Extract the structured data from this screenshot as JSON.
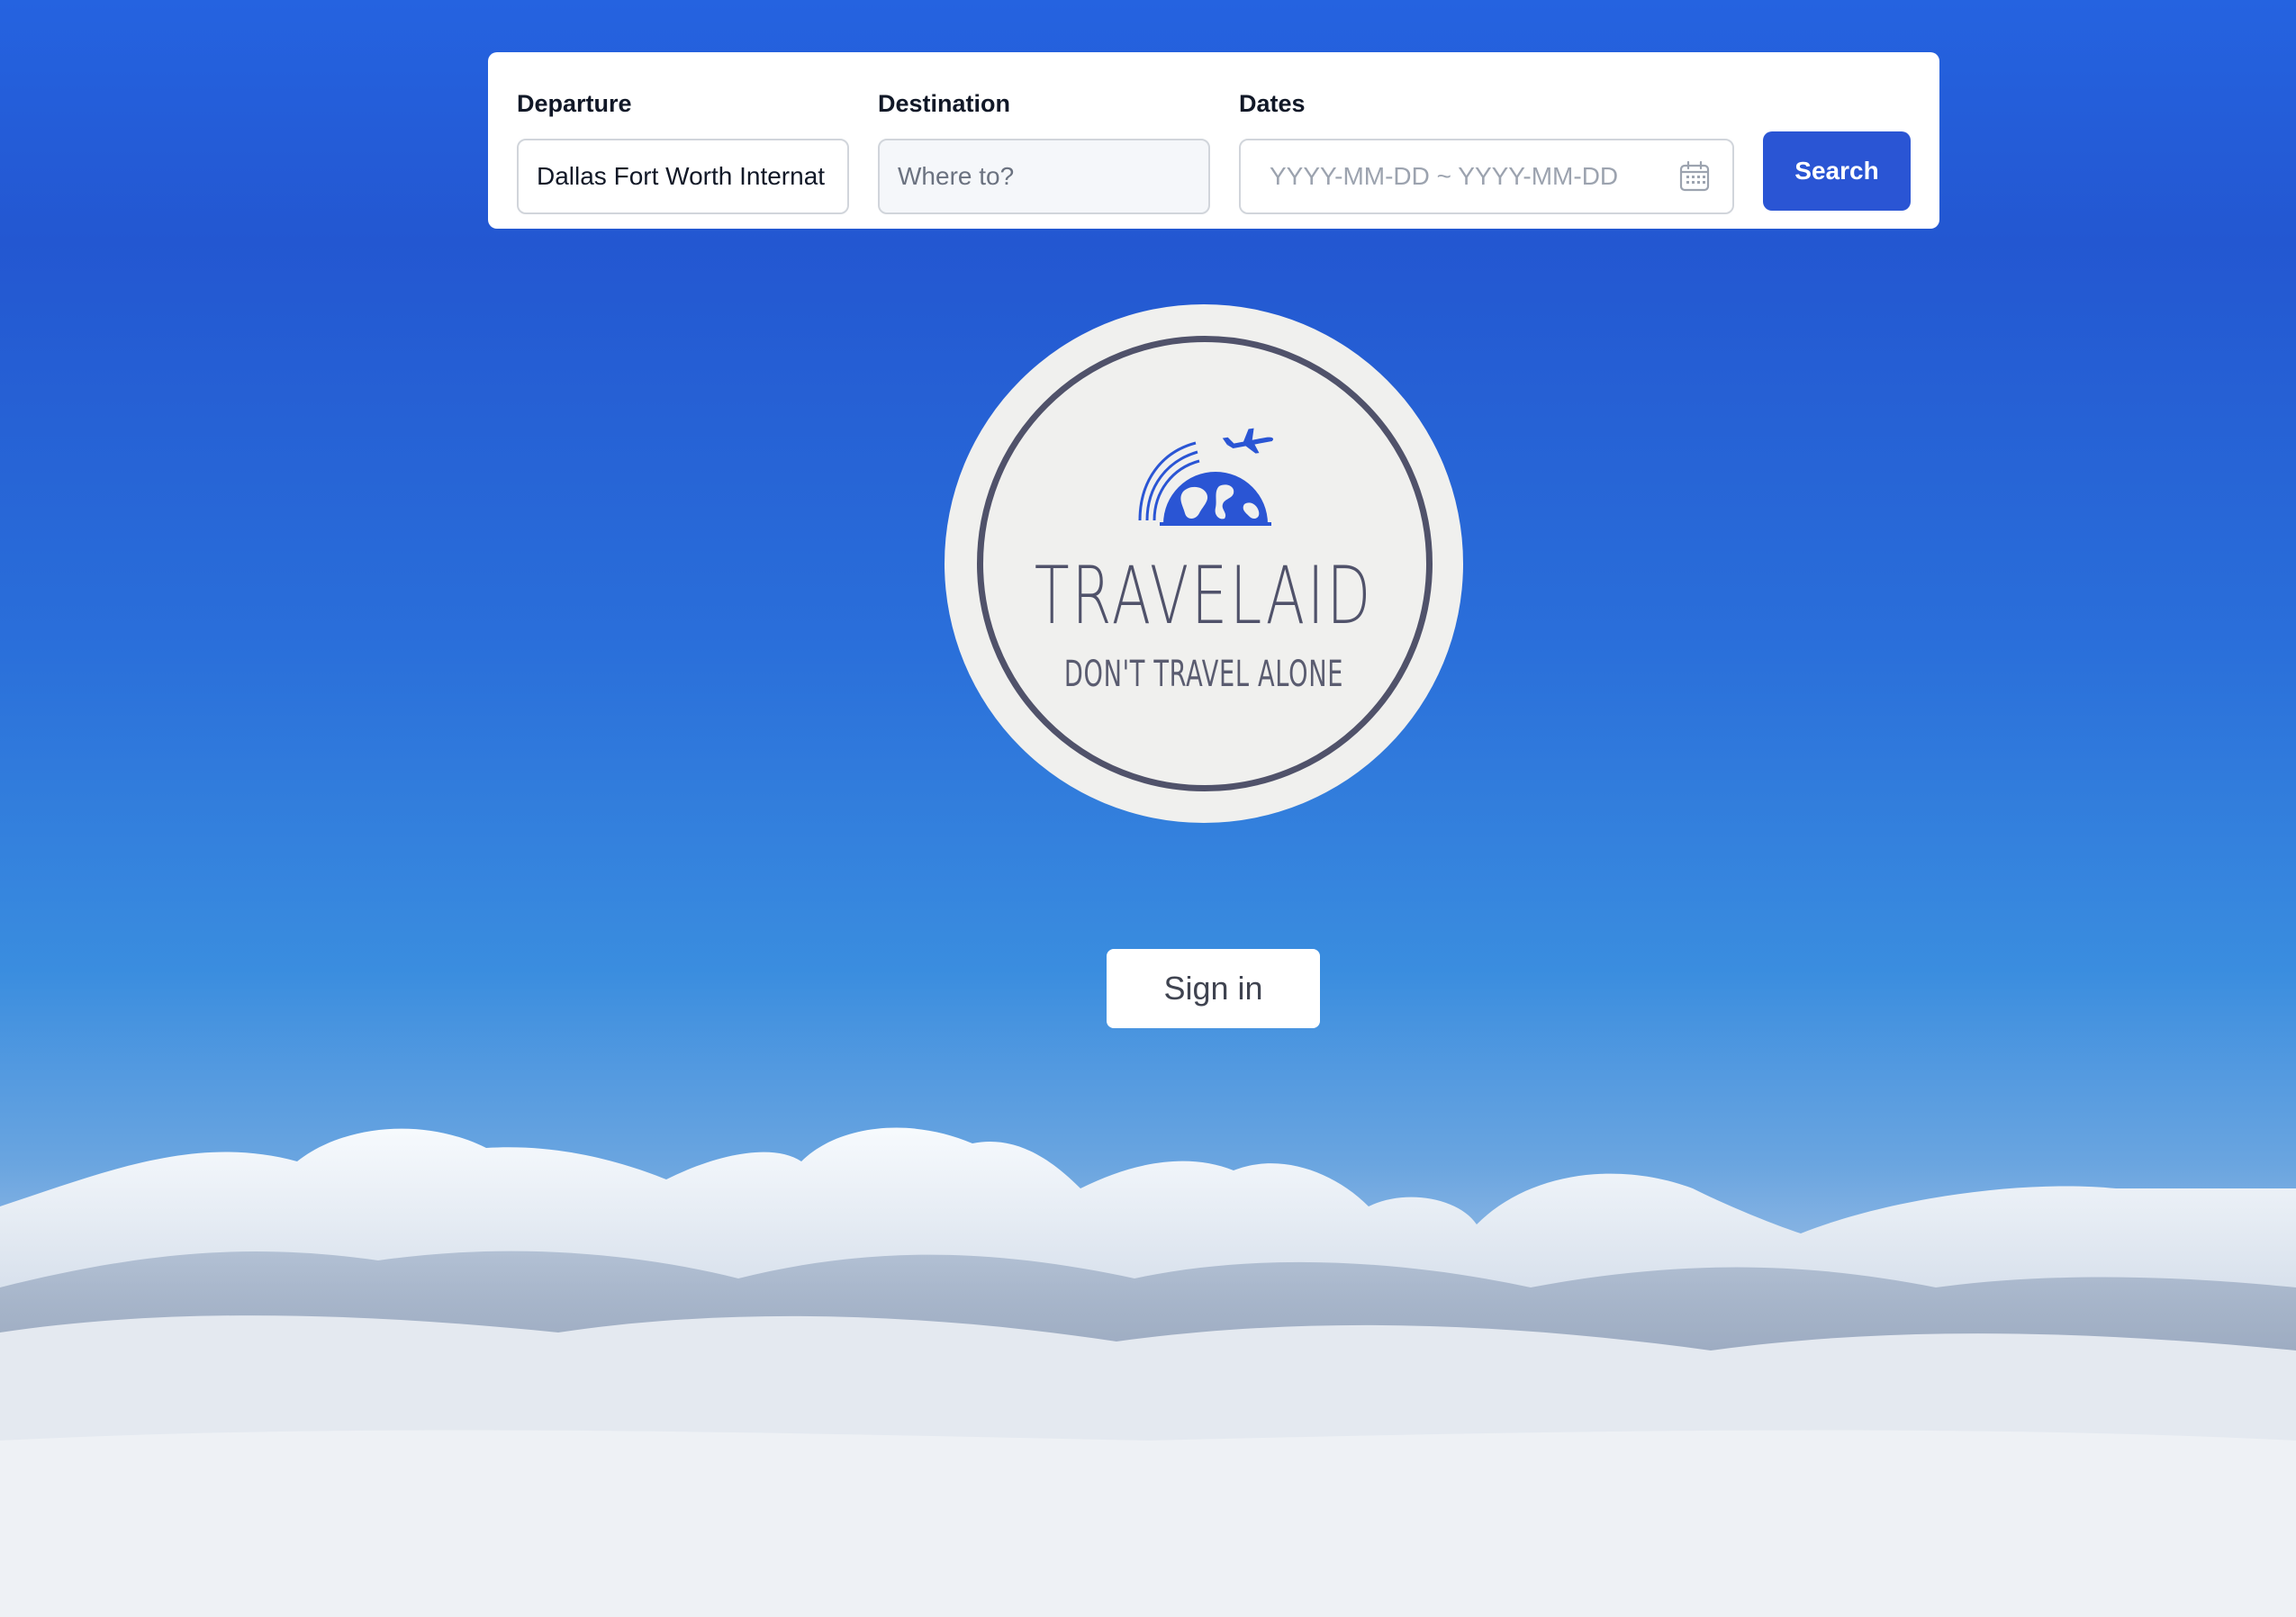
{
  "search": {
    "departure_label": "Departure",
    "departure_value": "Dallas Fort Worth Internat",
    "destination_label": "Destination",
    "destination_placeholder": "Where to?",
    "dates_label": "Dates",
    "dates_placeholder": "YYYY-MM-DD ~ YYYY-MM-DD",
    "search_label": "Search"
  },
  "logo": {
    "title": "TRAVELAID",
    "tagline": "DON'T TRAVEL ALONE"
  },
  "auth": {
    "signin_label": "Sign in"
  },
  "colors": {
    "accent": "#2a55d4",
    "logo_text": "#50526a",
    "sky": "#2563e0"
  },
  "icons": {
    "calendar": "calendar-icon",
    "globe": "globe-plane-icon"
  }
}
